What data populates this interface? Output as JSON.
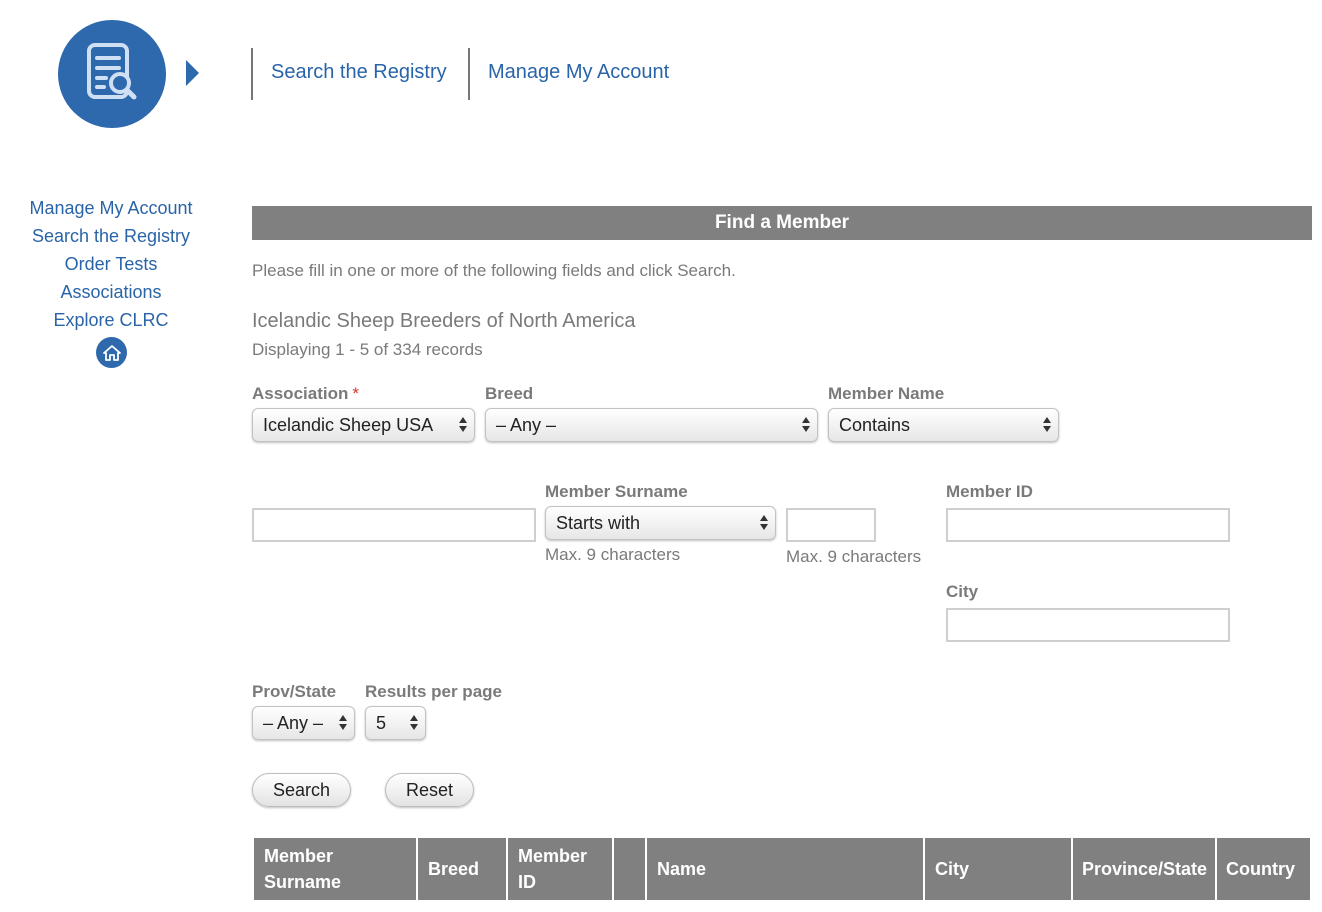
{
  "topnav": {
    "links": [
      "Search the Registry",
      "Manage My Account"
    ]
  },
  "sidebar": {
    "items": [
      "Manage My Account",
      "Search the Registry",
      "Order Tests",
      "Associations",
      "Explore CLRC"
    ]
  },
  "section": {
    "title": "Find a Member",
    "intro": "Please fill in one or more of the following fields and click Search.",
    "association_title": "Icelandic Sheep Breeders of North America",
    "record_count": "Displaying 1 - 5 of 334 records"
  },
  "form": {
    "association": {
      "label": "Association",
      "required_mark": "*",
      "value": "Icelandic Sheep USA"
    },
    "breed": {
      "label": "Breed",
      "value": "– Any –"
    },
    "member_name": {
      "label": "Member Name",
      "mode": "Contains",
      "value": ""
    },
    "member_surname": {
      "label": "Member Surname",
      "mode": "Starts with",
      "mode_hint": "Max. 9 characters",
      "value": "",
      "hint": "Max. 9 characters"
    },
    "member_id": {
      "label": "Member ID",
      "value": ""
    },
    "city": {
      "label": "City",
      "value": ""
    },
    "prov_state": {
      "label": "Prov/State",
      "value": "– Any –"
    },
    "results_per_page": {
      "label": "Results per page",
      "value": "5"
    },
    "search_button": "Search",
    "reset_button": "Reset"
  },
  "table": {
    "columns": [
      "Member Surname",
      "Breed",
      "Member ID",
      "",
      "Name",
      "City",
      "Province/State",
      "Country"
    ]
  },
  "colors": {
    "brand_blue": "#2e68ad",
    "link_blue": "#2a64a8",
    "header_gray": "#808080",
    "required_red": "#d9332c"
  },
  "icons": {
    "logo": "document-search-icon",
    "home": "home-icon",
    "nav_arrow": "chevron-right-icon"
  }
}
